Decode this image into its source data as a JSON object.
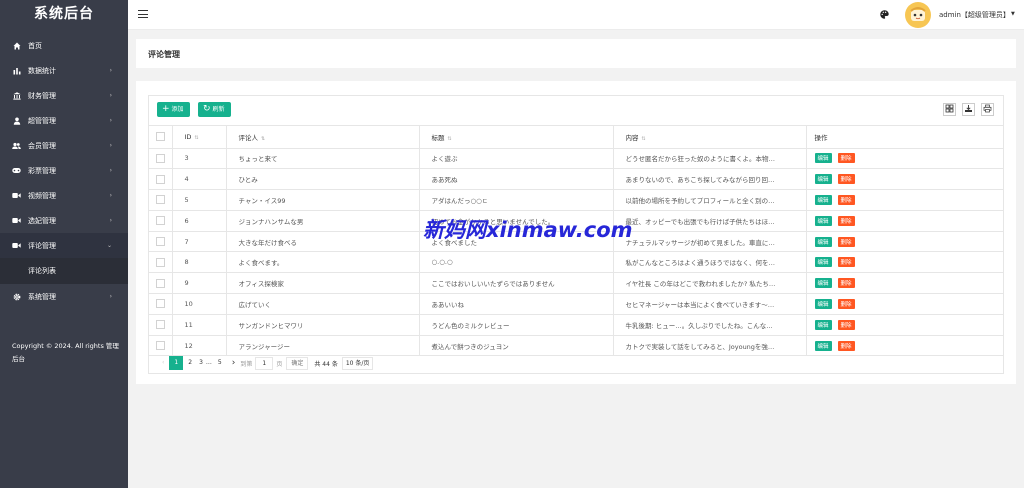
{
  "app": {
    "title": "系统后台"
  },
  "sidebar": {
    "items": [
      {
        "label": "首页",
        "icon": "home-icon",
        "arrow": ""
      },
      {
        "label": "数据统计",
        "icon": "bar-chart-icon",
        "arrow": "›"
      },
      {
        "label": "财务管理",
        "icon": "bank-icon",
        "arrow": "›"
      },
      {
        "label": "超管管理",
        "icon": "user-icon",
        "arrow": "›"
      },
      {
        "label": "会员管理",
        "icon": "users-icon",
        "arrow": "›"
      },
      {
        "label": "彩票管理",
        "icon": "gamepad-icon",
        "arrow": "›"
      },
      {
        "label": "视频管理",
        "icon": "video-icon",
        "arrow": "›"
      },
      {
        "label": "选妃管理",
        "icon": "video-icon",
        "arrow": "›"
      },
      {
        "label": "评论管理",
        "icon": "video-icon",
        "arrow": "⌄"
      }
    ],
    "sub_item": "评论列表",
    "system": {
      "label": "系统管理",
      "icon": "gear-icon",
      "arrow": "›"
    },
    "copyright": "Copyright © 2024. All rights 管理后台"
  },
  "header": {
    "user": "admin【超级管理员】",
    "caret": "▼"
  },
  "page": {
    "title": "评论管理"
  },
  "toolbar": {
    "add_label": "添加",
    "refresh_label": "刷新"
  },
  "table": {
    "columns": [
      "ID",
      "评论人",
      "标题",
      "内容",
      "操作"
    ],
    "rows": [
      {
        "id": "3",
        "user": "ちょっと来て",
        "title": "よく遊ぶ",
        "content": "どうせ匿名だから狂った奴のように書くよ。本物…"
      },
      {
        "id": "4",
        "user": "ひとみ",
        "title": "ああ死ぬ",
        "content": "あまりないので、あちこち探してみながら回り回…"
      },
      {
        "id": "5",
        "user": "チャン・イス99",
        "title": "アダはんだっ○○ㄷ",
        "content": "以前他の場所を予約してプロフィールと全く別の…"
      },
      {
        "id": "6",
        "user": "ジョンナハンサムな男",
        "title": "初めてお金がかかると思いませんでした。",
        "content": "最近、オッピーでも出張でも行けば子供たちはほ…"
      },
      {
        "id": "7",
        "user": "大きな年だけ食べる",
        "title": "よく食べました",
        "content": "ナチュラルマッサージが初めて見ました。車直に…"
      },
      {
        "id": "8",
        "user": "よく食べます。",
        "title": "○.○.○",
        "content": "私がこんなところはよく通うほうではなく、何を…"
      },
      {
        "id": "9",
        "user": "オフィス探検家",
        "title": "ここではおいしいいたずらではありません",
        "content": "イヤ社長 この年はどこで救われましたか? 私たち…"
      },
      {
        "id": "10",
        "user": "広げていく",
        "title": "ああいいね",
        "content": "セヒマネージャーは本当によく食べていきます～…"
      },
      {
        "id": "11",
        "user": "サンガンドンヒマワリ",
        "title": "うどん色のミルクレビュー",
        "content": "牛乳後期: ヒュー…。久しぶりでしたね。こんな…"
      },
      {
        "id": "12",
        "user": "アランジャージー",
        "title": "煮込んで餅つきのジュヨン",
        "content": "カトクで実装して話をしてみると、Joyoungを強…"
      }
    ],
    "edit_label": "编辑",
    "delete_label": "删除"
  },
  "pagination": {
    "prev": "‹",
    "pages": [
      "1",
      "2",
      "3",
      "…",
      "5"
    ],
    "next": "›",
    "goto_prefix": "到第",
    "goto_value": "1",
    "goto_suffix": "页",
    "confirm": "确定",
    "total": "共 44 条",
    "page_size": "10 条/页"
  },
  "watermark": "新妈网xinmaw.com",
  "colors": {
    "accent": "#16b18e",
    "danger": "#ff5722",
    "sidebar": "#393d49"
  }
}
